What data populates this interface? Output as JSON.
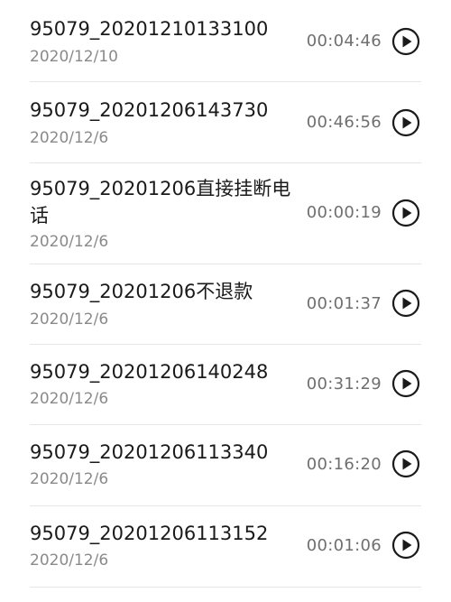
{
  "recordings": [
    {
      "title": "95079_20201210133100",
      "date": "2020/12/10",
      "duration": "00:04:46",
      "icon": "play-circle-icon"
    },
    {
      "title": "95079_20201206143730",
      "date": "2020/12/6",
      "duration": "00:46:56",
      "icon": "play-circle-icon"
    },
    {
      "title": "95079_20201206直接挂断电话",
      "date": "2020/12/6",
      "duration": "00:00:19",
      "icon": "play-circle-icon"
    },
    {
      "title": "95079_20201206不退款",
      "date": "2020/12/6",
      "duration": "00:01:37",
      "icon": "play-circle-icon"
    },
    {
      "title": "95079_20201206140248",
      "date": "2020/12/6",
      "duration": "00:31:29",
      "icon": "play-circle-icon"
    },
    {
      "title": "95079_20201206113340",
      "date": "2020/12/6",
      "duration": "00:16:20",
      "icon": "play-circle-icon"
    },
    {
      "title": "95079_20201206113152",
      "date": "2020/12/6",
      "duration": "00:01:06",
      "icon": "play-circle-icon"
    }
  ]
}
